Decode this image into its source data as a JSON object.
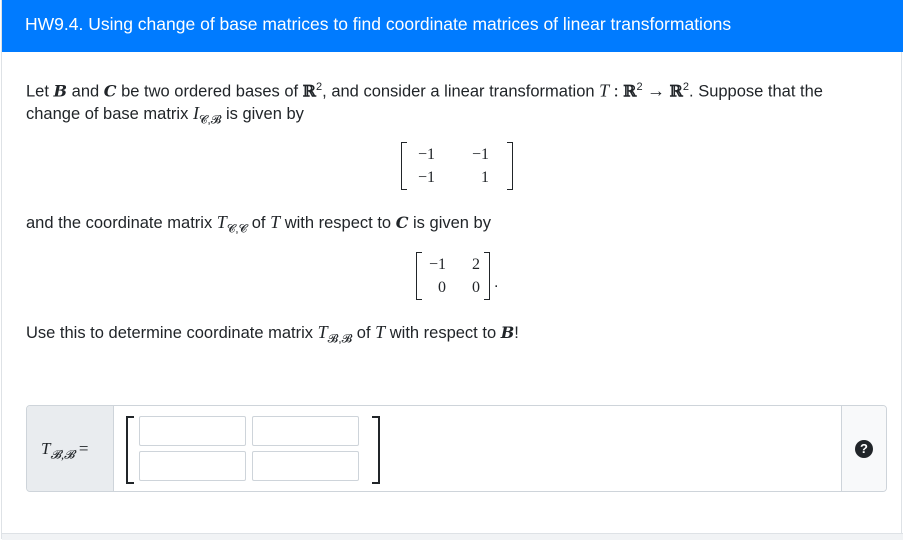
{
  "header": {
    "title": "HW9.4. Using change of base matrices to find coordinate matrices of linear transformations"
  },
  "problem": {
    "p1_a": "Let",
    "sym_B": "B",
    "p1_and": "and",
    "sym_C": "C",
    "p1_b": "be two ordered bases of",
    "sym_R": "ℝ",
    "sup2": "2",
    "p1_c": ", and consider a linear transformation",
    "sym_T": "T",
    "colon": " : ",
    "arrow": " → ",
    "p1_d": ". Suppose that the",
    "p2_a": "change of base matrix",
    "sym_I": "I",
    "sub_CB": "𝓒,𝓑",
    "p2_b": "is given by",
    "matrix1": [
      "−1",
      "−1",
      "−1",
      "1"
    ],
    "p3_a": "and the coordinate matrix",
    "sub_CC": "𝓒,𝓒",
    "p3_b": "of",
    "p3_c": "with respect to",
    "p3_d": "is given by",
    "matrix2": [
      "−1",
      "2",
      "0",
      "0"
    ],
    "period": ".",
    "p4_a": "Use this to determine coordinate matrix",
    "sub_BB": "𝓑,𝓑",
    "p4_b": "of",
    "p4_c": "with respect to",
    "p4_d": "!"
  },
  "answer": {
    "label_T": "T",
    "label_sub": "𝓑,𝓑",
    "label_eq": " =",
    "inputs": [
      "",
      "",
      "",
      ""
    ],
    "help_icon": "question-circle-icon",
    "help_glyph": "?"
  }
}
